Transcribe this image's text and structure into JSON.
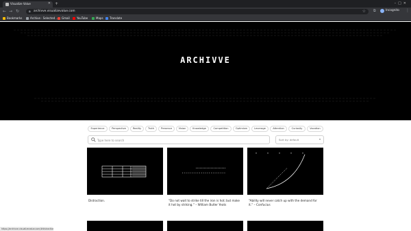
{
  "browser": {
    "tab_title": "Visualize Value",
    "url": "archivve.visualizevalue.com",
    "profile_name": "Incognito",
    "bookmarks": [
      {
        "label": "Bookmarks",
        "color": "#fbbc04"
      },
      {
        "label": "Archive · Selected …",
        "color": "#9aa0a6"
      },
      {
        "label": "Gmail",
        "color": "#ea4335"
      },
      {
        "label": "YouTube",
        "color": "#ff0000"
      },
      {
        "label": "Maps",
        "color": "#34a853"
      },
      {
        "label": "Translate",
        "color": "#4285f4"
      }
    ]
  },
  "hero": {
    "title": "ARCHIVVE"
  },
  "filters": [
    "Experience",
    "Perspective",
    "Reality",
    "Truth",
    "Presence",
    "Vision",
    "Knowledge",
    "Competition",
    "Optimism",
    "Leverage",
    "Attention",
    "Curiosity",
    "Vocation"
  ],
  "search": {
    "placeholder": "Type here to search"
  },
  "sort": {
    "label": "Sort by: default"
  },
  "cards": [
    {
      "caption": "Distraction."
    },
    {
      "caption": "“Do not wait to strike till the iron is hot; but make it hot by striking.” – William Butler Yeats"
    },
    {
      "caption": "“Ability will never catch up with the demand for it.” – Confucius"
    }
  ],
  "statusbar": {
    "text": "https://archivve.visualizevalue.com/#distraction"
  }
}
